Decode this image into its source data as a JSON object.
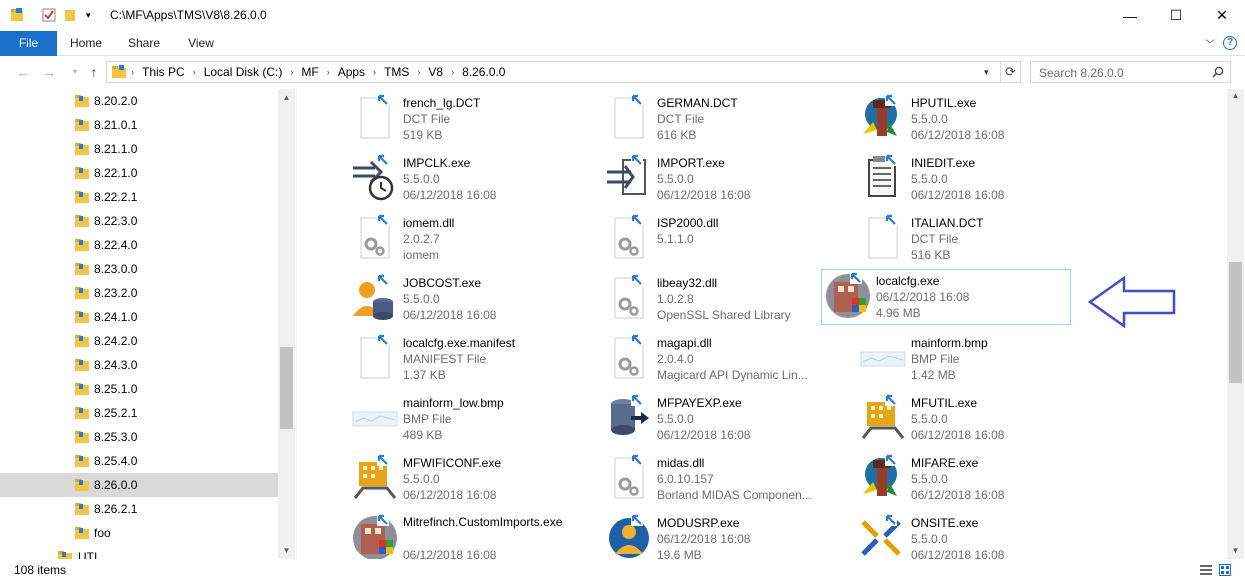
{
  "window": {
    "title": "C:\\MF\\Apps\\TMS\\V8\\8.26.0.0",
    "minimize": "—",
    "maximize": "☐",
    "close": "✕"
  },
  "ribbon": {
    "tabs": [
      "File",
      "Home",
      "Share",
      "View"
    ]
  },
  "address": {
    "crumbs": [
      "This PC",
      "Local Disk (C:)",
      "MF",
      "Apps",
      "TMS",
      "V8",
      "8.26.0.0"
    ],
    "search_placeholder": "Search 8.26.0.0"
  },
  "nav": {
    "items": [
      "8.20.2.0",
      "8.21.0.1",
      "8.21.1.0",
      "8.22.1.0",
      "8.22.2.1",
      "8.22.3.0",
      "8.22.4.0",
      "8.23.0.0",
      "8.23.2.0",
      "8.24.1.0",
      "8.24.2.0",
      "8.24.3.0",
      "8.25.1.0",
      "8.25.2.1",
      "8.25.3.0",
      "8.25.4.0",
      "8.26.0.0",
      "8.26.2.1",
      "foo",
      "UTI"
    ],
    "selected": "8.26.0.0"
  },
  "files": [
    {
      "name": "french_lg.DCT",
      "line2": "DCT File",
      "line3": "519 KB",
      "icon": "document-icon"
    },
    {
      "name": "GERMAN.DCT",
      "line2": "DCT File",
      "line3": "616 KB",
      "icon": "document-icon"
    },
    {
      "name": "HPUTIL.exe",
      "line2": "5.5.0.0",
      "line3": "06/12/2018 16:08",
      "icon": "tower-app-icon"
    },
    {
      "name": "IMPCLK.exe",
      "line2": "5.5.0.0",
      "line3": "06/12/2018 16:08",
      "icon": "clock-import-icon"
    },
    {
      "name": "IMPORT.exe",
      "line2": "5.5.0.0",
      "line3": "06/12/2018 16:08",
      "icon": "import-icon"
    },
    {
      "name": "INIEDIT.exe",
      "line2": "5.5.0.0",
      "line3": "06/12/2018 16:08",
      "icon": "notepad-icon"
    },
    {
      "name": "iomem.dll",
      "line2": "2.0.2.7",
      "line3": "iomem",
      "icon": "dll-gear-icon"
    },
    {
      "name": "ISP2000.dll",
      "line2": "5.1.1.0",
      "line3": "",
      "icon": "dll-gear-icon"
    },
    {
      "name": "ITALIAN.DCT",
      "line2": "DCT File",
      "line3": "516 KB",
      "icon": "document-icon"
    },
    {
      "name": "JOBCOST.exe",
      "line2": "5.5.0.0",
      "line3": "06/12/2018 16:08",
      "icon": "user-database-icon"
    },
    {
      "name": "libeay32.dll",
      "line2": "1.0.2.8",
      "line3": "OpenSSL Shared Library",
      "icon": "dll-gear-icon"
    },
    {
      "name": "localcfg.exe",
      "line2": "06/12/2018 16:08",
      "line3": "4.96 MB",
      "icon": "building-globe-icon"
    },
    {
      "name": "localcfg.exe.manifest",
      "line2": "MANIFEST File",
      "line3": "1.37 KB",
      "icon": "document-icon"
    },
    {
      "name": "magapi.dll",
      "line2": "2.0.4.0",
      "line3": "Magicard API Dynamic Lin...",
      "icon": "dll-gear-icon"
    },
    {
      "name": "mainform.bmp",
      "line2": "BMP File",
      "line3": "1.42 MB",
      "icon": "bitmap-icon"
    },
    {
      "name": "mainform_low.bmp",
      "line2": "BMP File",
      "line3": "489 KB",
      "icon": "bitmap-icon"
    },
    {
      "name": "MFPAYEXP.exe",
      "line2": "5.5.0.0",
      "line3": "06/12/2018 16:08",
      "icon": "database-export-icon"
    },
    {
      "name": "MFUTIL.exe",
      "line2": "5.5.0.0",
      "line3": "06/12/2018 16:08",
      "icon": "building-tool-icon"
    },
    {
      "name": "MFWIFICONF.exe",
      "line2": "5.5.0.0",
      "line3": "06/12/2018 16:08",
      "icon": "building-tool-icon"
    },
    {
      "name": "midas.dll",
      "line2": "6.0.10.157",
      "line3": "Borland MIDAS Componen...",
      "icon": "dll-gear-icon"
    },
    {
      "name": "MIFARE.exe",
      "line2": "5.5.0.0",
      "line3": "06/12/2018 16:08",
      "icon": "tower-app-icon"
    },
    {
      "name": "Mitrefinch.CustomImports.exe",
      "line2": "",
      "line3": "06/12/2018 16:08",
      "icon": "building-globe-icon"
    },
    {
      "name": "MODUSRP.exe",
      "line2": "06/12/2018 16:08",
      "line3": "19.6 MB",
      "icon": "globe-person-icon"
    },
    {
      "name": "ONSITE.exe",
      "line2": "5.5.0.0",
      "line3": "06/12/2018 16:08",
      "icon": "arrows-icon"
    }
  ],
  "selected_file": "localcfg.exe",
  "status": {
    "count": "108 items"
  },
  "colors": {
    "accent": "#1a6fcb",
    "selection": "#99d1ff",
    "annotation_arrow": "#3f4fc4"
  }
}
